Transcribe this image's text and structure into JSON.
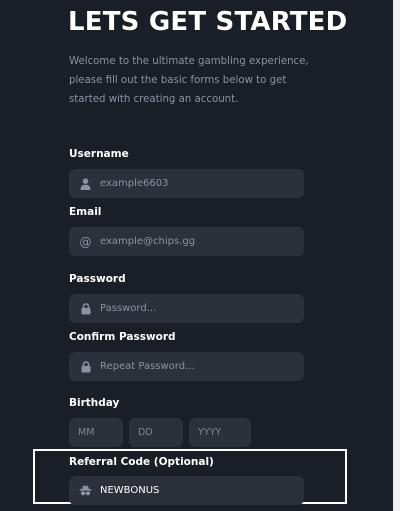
{
  "header": {
    "title": "LETS GET STARTED",
    "intro": "Welcome to the ultimate gambling experience, please fill out the basic forms below to get started with creating an account."
  },
  "form": {
    "username": {
      "label": "Username",
      "placeholder": "example6603",
      "icon": "user-icon"
    },
    "email": {
      "label": "Email",
      "placeholder": "example@chips.gg",
      "icon": "at-icon"
    },
    "password": {
      "label": "Password",
      "placeholder": "Password...",
      "icon": "lock-icon"
    },
    "confirm_password": {
      "label": "Confirm Password",
      "placeholder": "Repeat Password...",
      "icon": "lock-icon"
    },
    "birthday": {
      "label": "Birthday",
      "month_placeholder": "MM",
      "day_placeholder": "DD",
      "year_placeholder": "YYYY"
    },
    "referral": {
      "label": "Referral Code (Optional)",
      "value": "NEWBONUS",
      "icon": "spy-icon"
    }
  },
  "colors": {
    "background": "#191e27",
    "input_background": "#2b303a",
    "muted_text": "#8c93a0",
    "highlight_border": "#ffffff"
  }
}
